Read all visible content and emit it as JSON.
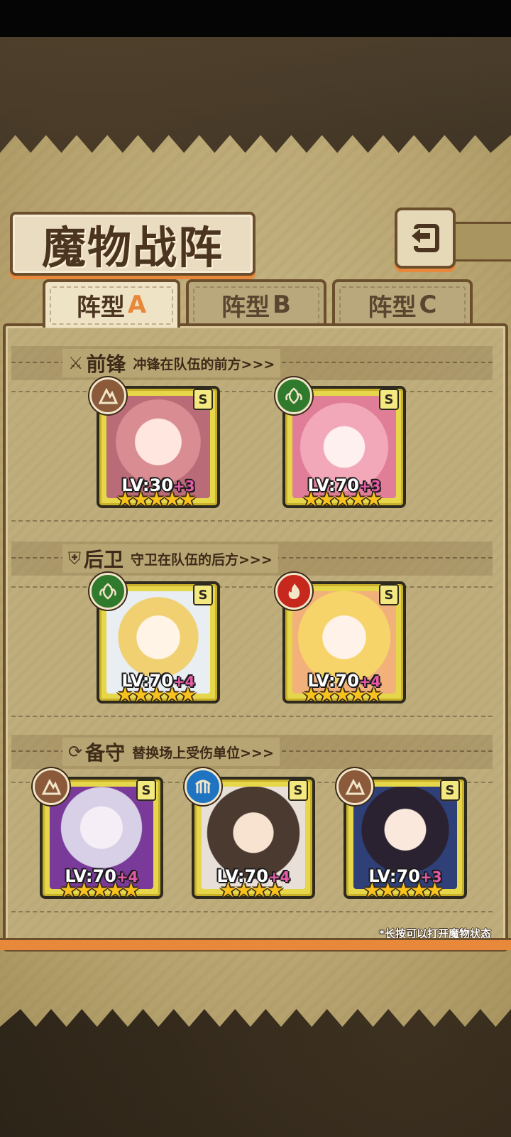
{
  "header": {
    "title": "魔物战阵",
    "back_icon": "back-arrow-icon"
  },
  "tabs": [
    {
      "prefix": "阵型",
      "letter": "A",
      "active": true
    },
    {
      "prefix": "阵型",
      "letter": "B",
      "active": false
    },
    {
      "prefix": "阵型",
      "letter": "C",
      "active": false
    }
  ],
  "sections": {
    "vanguard": {
      "title": "前锋",
      "desc": "冲锋在队伍的前方>>>"
    },
    "rearguard": {
      "title": "后卫",
      "desc": "守卫在队伍的后方>>>"
    },
    "reserve": {
      "title": "备守",
      "desc": "替换场上受伤单位>>>"
    }
  },
  "cards": {
    "v1": {
      "level": "LV:30",
      "plus": "+3",
      "stars": "★★★★★",
      "grade": "S",
      "element": "earth"
    },
    "v2": {
      "level": "LV:70",
      "plus": "+3",
      "stars": "★★★★★",
      "grade": "S",
      "element": "leaf"
    },
    "r1": {
      "level": "LV:70",
      "plus": "+4",
      "stars": "★★★★★",
      "grade": "S",
      "element": "leaf"
    },
    "r2": {
      "level": "LV:70",
      "plus": "+4",
      "stars": "★★★★★",
      "grade": "S",
      "element": "fire"
    },
    "s1": {
      "level": "LV:70",
      "plus": "+4",
      "stars": "★★★★★",
      "grade": "S",
      "element": "earth"
    },
    "s2": {
      "level": "LV:70",
      "plus": "+4",
      "stars": "★★★★",
      "grade": "S",
      "element": "water"
    },
    "s3": {
      "level": "LV:70",
      "plus": "+3",
      "stars": "★★★★★",
      "grade": "S",
      "element": "earth"
    }
  },
  "colors": {
    "earth": "#8a5a3a",
    "leaf": "#2f7a2c",
    "fire": "#c7281e",
    "water": "#1f74c2",
    "accent": "#e8883a"
  },
  "footnote": "*长按可以打开魔物状态"
}
